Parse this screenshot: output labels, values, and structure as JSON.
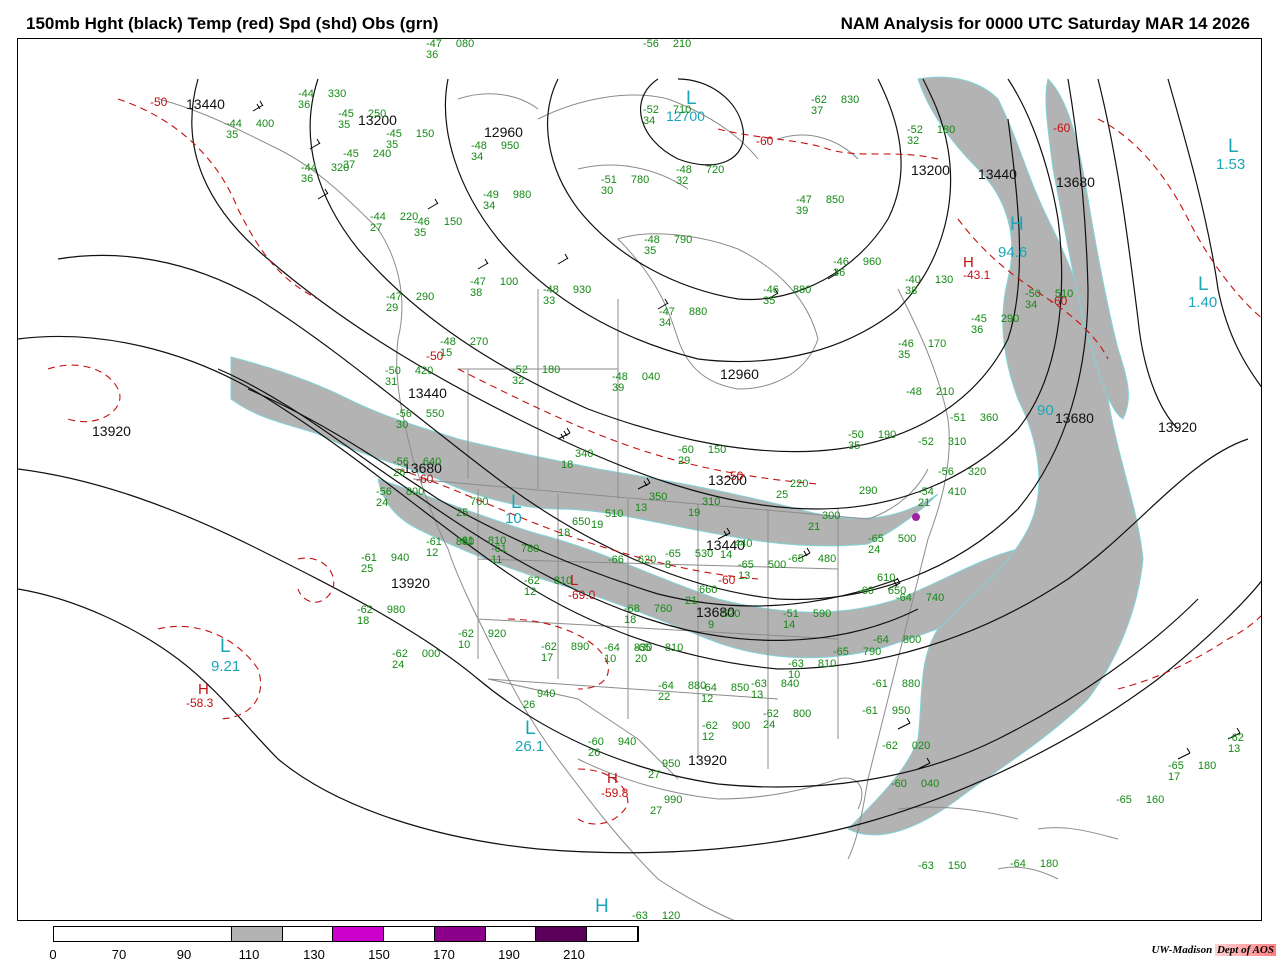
{
  "title": {
    "left": "150mb Hght (black) Temp (red) Spd (shd) Obs (grn)",
    "right": "NAM Analysis for 0000 UTC Saturday  MAR 14 2026"
  },
  "colors": {
    "height": "#111111",
    "temperature": "#c41010",
    "obs": "#138a13",
    "shade": "#b3b3b3",
    "centers": "#1ba6b8",
    "map": "#8c8c8c"
  },
  "height_labels": [
    "13440",
    "13200",
    "12960",
    "12700",
    "13200",
    "13440",
    "13680",
    "13920",
    "13440",
    "13680",
    "12960",
    "13200",
    "13440",
    "13680",
    "13920",
    "13920",
    "13920",
    "13680"
  ],
  "centers": [
    {
      "symbol": "L",
      "value": "12700"
    },
    {
      "symbol": "L",
      "value": "1.53"
    },
    {
      "symbol": "L",
      "value": "1.40"
    },
    {
      "symbol": "H",
      "value": "94.6"
    },
    {
      "symbol": "L",
      "value": "9.21"
    },
    {
      "symbol": "L",
      "value": "26.1"
    },
    {
      "symbol": "L",
      "value": "10"
    },
    {
      "symbol": "H",
      "value": ""
    },
    {
      "symbol": "L",
      "value": "90"
    }
  ],
  "temp_centers": [
    {
      "symbol": "H",
      "value": "-43.1"
    },
    {
      "symbol": "H",
      "value": "-58.3"
    },
    {
      "symbol": "H",
      "value": "-59.8"
    },
    {
      "symbol": "L",
      "value": "-69.0"
    }
  ],
  "temp_labels": [
    "-50",
    "-60",
    "-60",
    "-50",
    "-60",
    "-60",
    "-50",
    "-60"
  ],
  "observations": [
    {
      "t": "-47",
      "d": "36",
      "p": "080"
    },
    {
      "t": "-56",
      "d": "",
      "p": "210"
    },
    {
      "t": "-52",
      "d": "34",
      "p": "710"
    },
    {
      "t": "-62",
      "d": "37",
      "p": "830"
    },
    {
      "t": "-44",
      "d": "36",
      "p": "330"
    },
    {
      "t": "-45",
      "d": "35",
      "p": "250"
    },
    {
      "t": "-44",
      "d": "35",
      "p": "400"
    },
    {
      "t": "-45",
      "d": "35",
      "p": "150"
    },
    {
      "t": "-45",
      "d": "37",
      "p": "240"
    },
    {
      "t": "-44",
      "d": "36",
      "p": "320"
    },
    {
      "t": "-48",
      "d": "34",
      "p": "950"
    },
    {
      "t": "-51",
      "d": "30",
      "p": "780"
    },
    {
      "t": "-48",
      "d": "32",
      "p": "720"
    },
    {
      "t": "-52",
      "d": "32",
      "p": "180"
    },
    {
      "t": "-49",
      "d": "34",
      "p": "980"
    },
    {
      "t": "-47",
      "d": "39",
      "p": "850"
    },
    {
      "t": "-44",
      "d": "27",
      "p": "220"
    },
    {
      "t": "-46",
      "d": "35",
      "p": "150"
    },
    {
      "t": "-48",
      "d": "35",
      "p": "790"
    },
    {
      "t": "-46",
      "d": "36",
      "p": "960"
    },
    {
      "t": "-47",
      "d": "38",
      "p": "100"
    },
    {
      "t": "-48",
      "d": "33",
      "p": "930"
    },
    {
      "t": "-46",
      "d": "35",
      "p": "880"
    },
    {
      "t": "-40",
      "d": "38",
      "p": "130"
    },
    {
      "t": "-50",
      "d": "34",
      "p": "510"
    },
    {
      "t": "-47",
      "d": "29",
      "p": "290"
    },
    {
      "t": "-47",
      "d": "34",
      "p": "880"
    },
    {
      "t": "-45",
      "d": "36",
      "p": "290"
    },
    {
      "t": "-48",
      "d": "15",
      "p": "270"
    },
    {
      "t": "-52",
      "d": "32",
      "p": "180"
    },
    {
      "t": "-46",
      "d": "35",
      "p": "170"
    },
    {
      "t": "-50",
      "d": "31",
      "p": "420"
    },
    {
      "t": "-48",
      "d": "39",
      "p": "040"
    },
    {
      "t": "-48",
      "d": "",
      "p": "210"
    },
    {
      "t": "-56",
      "d": "30",
      "p": "550"
    },
    {
      "t": "-51",
      "d": "",
      "p": "360"
    },
    {
      "t": "-50",
      "d": "35",
      "p": "190"
    },
    {
      "t": "-52",
      "d": "",
      "p": "310"
    },
    {
      "t": "-56",
      "d": "26",
      "p": "640"
    },
    {
      "t": "",
      "d": "18",
      "p": "340"
    },
    {
      "t": "-60",
      "d": "29",
      "p": "150"
    },
    {
      "t": "-56",
      "d": "",
      "p": "320"
    },
    {
      "t": "-56",
      "d": "24",
      "p": "800"
    },
    {
      "t": "",
      "d": "25",
      "p": "700"
    },
    {
      "t": "-54",
      "d": "21",
      "p": "410"
    },
    {
      "t": "",
      "d": "19",
      "p": "510"
    },
    {
      "t": "",
      "d": "13",
      "p": "350"
    },
    {
      "t": "",
      "d": "19",
      "p": "310"
    },
    {
      "t": "",
      "d": "25",
      "p": "220"
    },
    {
      "t": "",
      "d": "21",
      "p": "300"
    },
    {
      "t": "",
      "d": "",
      "p": "290"
    },
    {
      "t": "",
      "d": "18",
      "p": "650"
    },
    {
      "t": "-61",
      "d": "12",
      "p": "880"
    },
    {
      "t": "-61",
      "d": "",
      "p": "810"
    },
    {
      "t": "-61",
      "d": "11",
      "p": "780"
    },
    {
      "t": "",
      "d": "14",
      "p": "440"
    },
    {
      "t": "-65",
      "d": "24",
      "p": "500"
    },
    {
      "t": "-61",
      "d": "25",
      "p": "940"
    },
    {
      "t": "-65",
      "d": "8",
      "p": "530"
    },
    {
      "t": "-65",
      "d": "13",
      "p": "500"
    },
    {
      "t": "-65",
      "d": "",
      "p": "480"
    },
    {
      "t": "-66",
      "d": "",
      "p": "620"
    },
    {
      "t": "-62",
      "d": "18",
      "p": "980"
    },
    {
      "t": "-62",
      "d": "12",
      "p": "810"
    },
    {
      "t": "",
      "d": "21",
      "p": "660"
    },
    {
      "t": "-68",
      "d": "18",
      "p": "760"
    },
    {
      "t": "",
      "d": "9",
      "p": "520"
    },
    {
      "t": "-64",
      "d": "",
      "p": "740"
    },
    {
      "t": "-60",
      "d": "",
      "p": "650"
    },
    {
      "t": "",
      "d": "",
      "p": "610"
    },
    {
      "t": "-51",
      "d": "14",
      "p": "590"
    },
    {
      "t": "-62",
      "d": "10",
      "p": "920"
    },
    {
      "t": "-62",
      "d": "24",
      "p": "000"
    },
    {
      "t": "-62",
      "d": "17",
      "p": "890"
    },
    {
      "t": "-64",
      "d": "10",
      "p": "830"
    },
    {
      "t": "-65",
      "d": "20",
      "p": "810"
    },
    {
      "t": "-63",
      "d": "10",
      "p": "810"
    },
    {
      "t": "-65",
      "d": "",
      "p": "790"
    },
    {
      "t": "-64",
      "d": "",
      "p": "800"
    },
    {
      "t": "",
      "d": "26",
      "p": "940"
    },
    {
      "t": "-64",
      "d": "22",
      "p": "880"
    },
    {
      "t": "-64",
      "d": "12",
      "p": "850"
    },
    {
      "t": "-63",
      "d": "13",
      "p": "840"
    },
    {
      "t": "-61",
      "d": "",
      "p": "880"
    },
    {
      "t": "-60",
      "d": "26",
      "p": "940"
    },
    {
      "t": "-62",
      "d": "12",
      "p": "900"
    },
    {
      "t": "-62",
      "d": "24",
      "p": "800"
    },
    {
      "t": "-61",
      "d": "",
      "p": "950"
    },
    {
      "t": "",
      "d": "27",
      "p": "950"
    },
    {
      "t": "-62",
      "d": "",
      "p": "020"
    },
    {
      "t": "-60",
      "d": "",
      "p": "040"
    },
    {
      "t": "",
      "d": "27",
      "p": "990"
    },
    {
      "t": "-62",
      "d": "13",
      "p": ""
    },
    {
      "t": "-65",
      "d": "17",
      "p": "180"
    },
    {
      "t": "-65",
      "d": "",
      "p": "160"
    },
    {
      "t": "-63",
      "d": "",
      "p": "150"
    },
    {
      "t": "-64",
      "d": "",
      "p": "180"
    },
    {
      "t": "-63",
      "d": "",
      "p": "120"
    }
  ],
  "colorbar": {
    "ticks": [
      "0",
      "70",
      "90",
      "110",
      "130",
      "150",
      "170",
      "190",
      "210"
    ],
    "colors": [
      "#ffffff",
      "#b3b3b3",
      "#ffffff",
      "#cc00cc",
      "#ffffff",
      "#8b008b",
      "#ffffff",
      "#5a005a",
      "#ffffff"
    ]
  },
  "credit": {
    "org": "UW-Madison",
    "dept": "Dept of AOS"
  }
}
